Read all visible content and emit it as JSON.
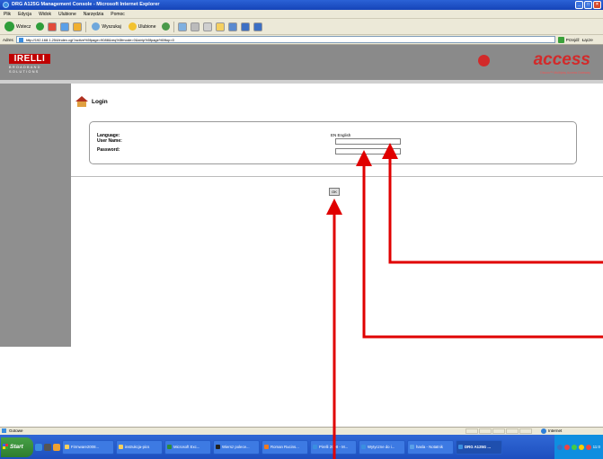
{
  "window": {
    "title": "DRG A125G Management Console - Microsoft Internet Explorer"
  },
  "menu": [
    "Plik",
    "Edycja",
    "Widok",
    "Ulubione",
    "Narzędzia",
    "Pomoc"
  ],
  "toolbar": {
    "back": "Wstecz",
    "search": "Wyszukaj",
    "favorites": "Ulubione"
  },
  "address": {
    "label": "Adres",
    "url": "http://192.168.1.254/index.cgi?active%5fpage=9088&req%5fmode=0&strip%5fpage%5ftop=0",
    "go": "Przejdź",
    "links": "Łącze"
  },
  "brand": {
    "logo": "IRELLI",
    "sub": "BROADBAND SOLUTIONS",
    "product": "access",
    "tagline": "Discus™ Multiplay Access Gateway"
  },
  "login": {
    "title": "Login",
    "language_label": "Language:",
    "language_value": "EN English",
    "username_label": "User Name:",
    "password_label": "Password:",
    "ok_label": "OK"
  },
  "statusbar": {
    "text": "Gotowe",
    "zone": "Internet"
  },
  "taskbar": {
    "start": "Start",
    "items": [
      "Firmware2008...",
      "instrukcja-pics",
      "Microsoft Exc...",
      "Wiersz polece...",
      "Roman Rucins...",
      "Pirelli 2008 - M...",
      "Wytyczne do i...",
      "hasla - Notatnik",
      "DRG A125G ..."
    ],
    "clock": "11:0"
  },
  "colors": {
    "annotation_arrow": "#e00000",
    "title_bar": "#2b62d6",
    "brand_red": "#c00000"
  }
}
